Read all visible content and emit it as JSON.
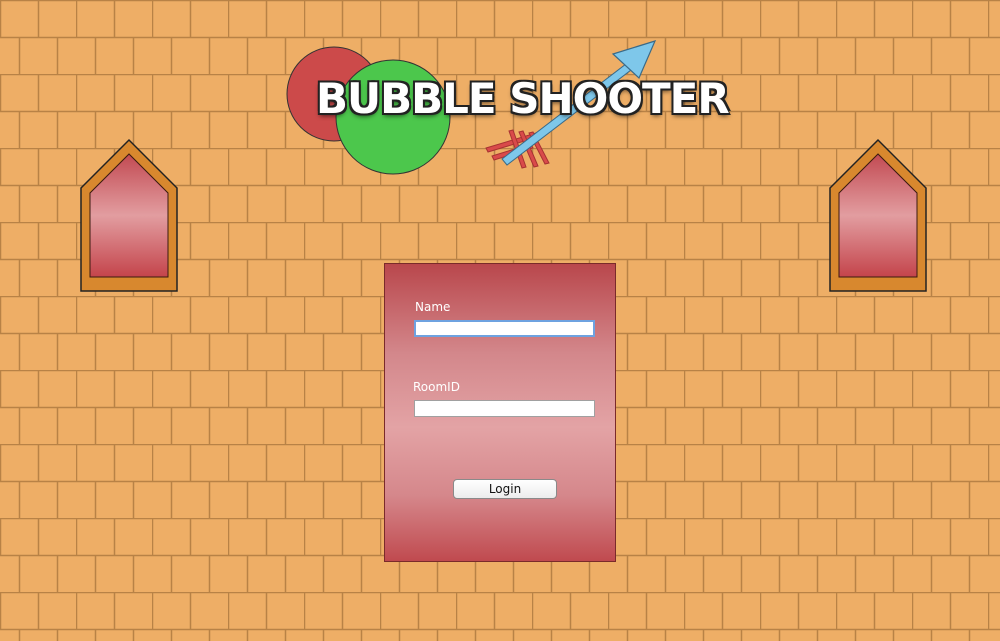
{
  "game": {
    "title": "BUBBLE SHOOTER"
  },
  "colors": {
    "brick": "#eeae66",
    "mortar": "#b88246",
    "window_frame": "#d8882e",
    "bubble_red": "#cc4a4a",
    "bubble_green": "#4cc74c",
    "arrow": "#7ec7ea"
  },
  "login": {
    "name_label": "Name",
    "name_value": "",
    "room_label": "RoomID",
    "room_value": "",
    "button_label": "Login"
  }
}
